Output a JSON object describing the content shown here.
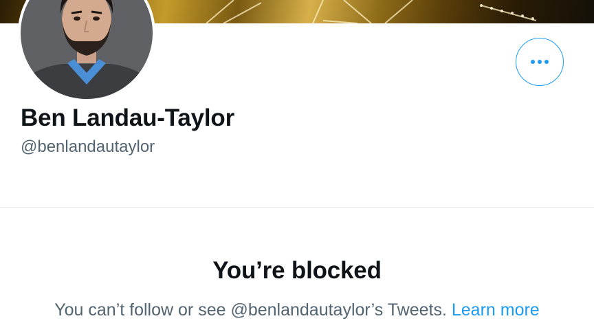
{
  "profile": {
    "display_name": "Ben Landau-Taylor",
    "handle": "@benlandautaylor",
    "avatar_icon": "profile-photo",
    "more_icon": "more-horizontal-icon"
  },
  "blocked": {
    "title": "You’re blocked",
    "message_text": "You can’t follow or see @benlandautaylor’s Tweets. ",
    "learn_more": "Learn more"
  },
  "colors": {
    "accent": "#1d9bf0",
    "primary_text": "#0f1419",
    "secondary_text": "#536471",
    "divider": "#e6e6e6"
  }
}
